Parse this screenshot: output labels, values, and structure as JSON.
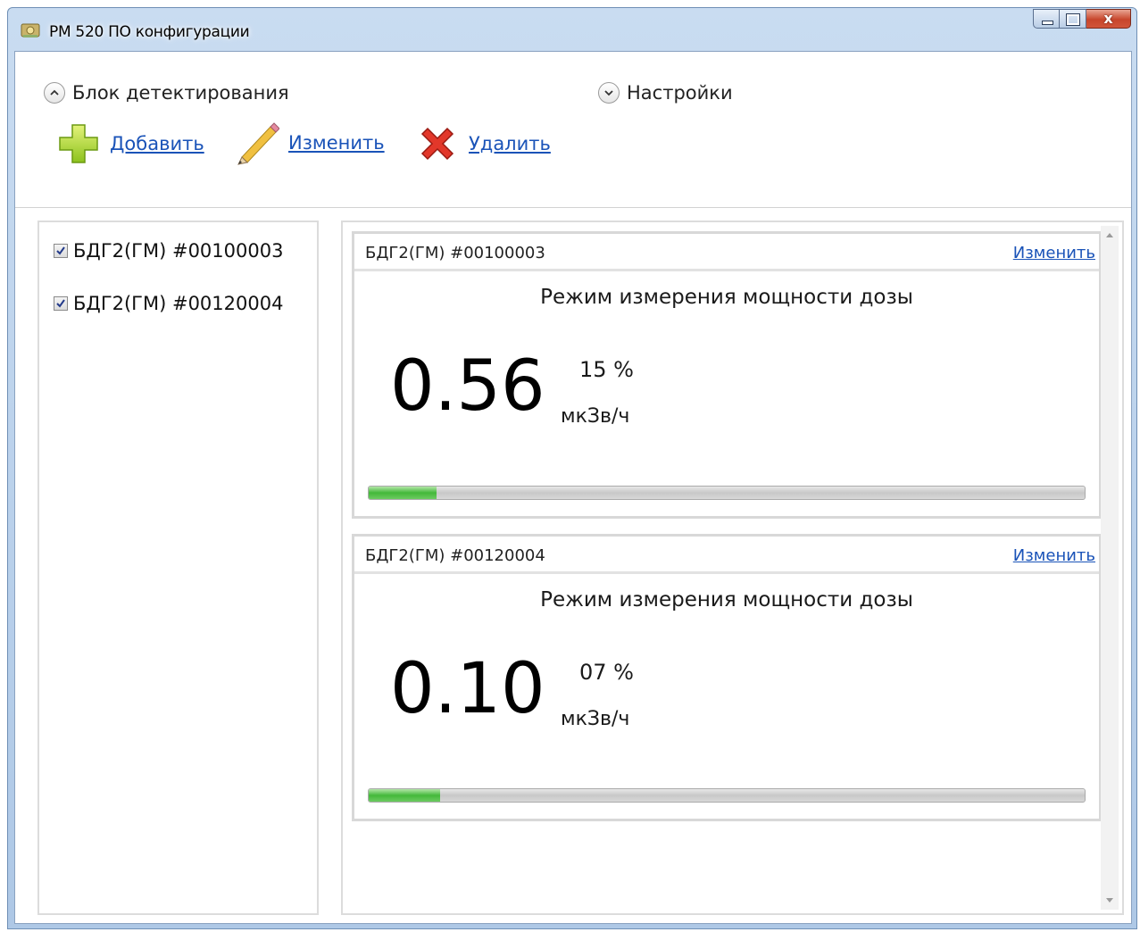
{
  "window": {
    "title": "РМ 520 ПО конфигурации",
    "close_label": "x"
  },
  "expanders": {
    "detection": {
      "label": "Блок детектирования",
      "state": "expanded"
    },
    "settings": {
      "label": "Настройки",
      "state": "collapsed"
    }
  },
  "toolbar": {
    "add_label": "Добавить",
    "edit_label": "Изменить",
    "delete_label": "Удалить"
  },
  "device_list": [
    {
      "label": "БДГ2(ГМ) #00100003",
      "checked": true
    },
    {
      "label": "БДГ2(ГМ) #00120004",
      "checked": true
    }
  ],
  "cards": [
    {
      "title": "БДГ2(ГМ) #00100003",
      "edit_label": "Изменить",
      "mode": "Режим измерения мощности дозы",
      "value": "0.56",
      "percent": "15 %",
      "unit": "мкЗв/ч",
      "progress": 0.095
    },
    {
      "title": "БДГ2(ГМ) #00120004",
      "edit_label": "Изменить",
      "mode": "Режим измерения мощности дозы",
      "value": "0.10",
      "percent": "07 %",
      "unit": "мкЗв/ч",
      "progress": 0.1
    }
  ],
  "colors": {
    "link": "#1a53b8",
    "progress_fill": "#43b83a",
    "close_button": "#c7452b"
  }
}
